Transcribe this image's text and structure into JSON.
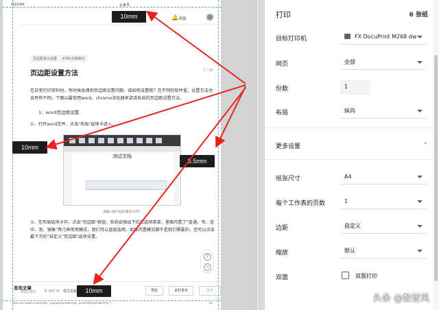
{
  "preview": {
    "date": "2021/4/4",
    "header_title": "头条号",
    "messages": "消息",
    "tag_category": "页边距怎么设置",
    "tag_stats": "4781次阅读过",
    "article_title": "页边距设置方法",
    "page_counter": "7 / 30",
    "para1": "在日常打印资料时，有时候会遇到页边距设置问题。该如何设置呢？在不同的软件里，设置方法也会有所不同。下面以最常用word、chrome浏览器来讲讲各自的页边距设置方法。",
    "heading1": "1、word页边距设置",
    "step1": "①、打开word文件，点击\"布局\"选项卡进入。",
    "screenshot_doc_title": "测试文档",
    "screenshot_caption": "请输入图片描述(最多50字)",
    "para2": "②、在布局选项卡中，点击\"页边距\"按钮，系统会弹出下拉式选项菜单，里面内置了\"普通、窄、适中、宽、镜像\"等几种常用模式，我们可以直接选用。如果内置模式都不是我们需要的，还可以点击最下方的\"自定义\"页边距\"选项设置。",
    "publish_title": "发布文章",
    "publish_sub": "草稿已保存",
    "word_count": "共 495 字",
    "send_settings": "发文设置",
    "btn_preview": "预览",
    "btn_schedule": "定时发布",
    "btn_publish": "发布",
    "url": "https://mp.toutiao.com/profile_v4/graphic/publish?pgc_id=6876533051362939277",
    "page_num": "1/8"
  },
  "callouts": {
    "top": "10mm",
    "left": "10mm",
    "right": "5.5mm",
    "bottom": "10mm"
  },
  "panel": {
    "title": "打印",
    "sheet_count": "6 张纸",
    "destination_label": "目标打印机",
    "destination_value": "FX DocuPrint M268 dw",
    "pages_label": "网页",
    "pages_value": "全部",
    "copies_label": "份数",
    "copies_value": "1",
    "layout_label": "布局",
    "layout_value": "纵向",
    "more_settings": "更多设置",
    "paper_size_label": "纸张尺寸",
    "paper_size_value": "A4",
    "pages_per_sheet_label": "每个工作表的页数",
    "pages_per_sheet_value": "1",
    "margins_label": "边距",
    "margins_value": "自定义",
    "scale_label": "缩放",
    "scale_value": "默认",
    "duplex_label": "双面",
    "duplex_option": "双面打印",
    "duplex_checked": false
  },
  "watermark": "头条 @数智风",
  "icons": [
    "printer-icon",
    "chevron-up-icon",
    "caret-down-icon",
    "bell-icon",
    "help-icon",
    "headset-icon"
  ],
  "colors": {
    "arrow": "#e8231c",
    "margin_guide": "#6aa5e0",
    "callout_bg": "#1d1d1d"
  }
}
